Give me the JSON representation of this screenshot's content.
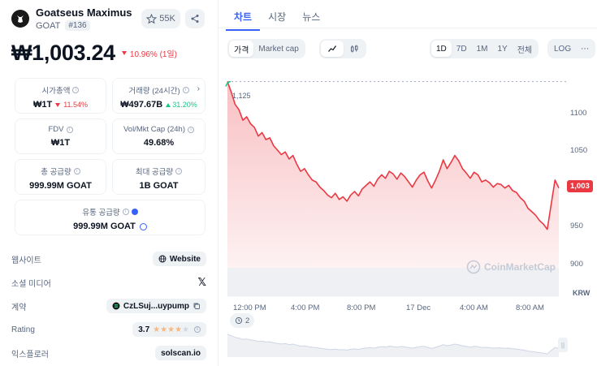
{
  "coin": {
    "name": "Goatseus Maximus",
    "symbol": "GOAT",
    "rank": "#136",
    "watchlist_count": "55K",
    "price": "₩1,003.24",
    "change": "10.96% (1일)"
  },
  "stats": {
    "market_cap": {
      "label": "시가총액",
      "value": "₩1T",
      "change": "11.54%"
    },
    "volume": {
      "label": "거래량 (24시간)",
      "value": "₩497.67B",
      "change": "31.20%"
    },
    "fdv": {
      "label": "FDV",
      "value": "₩1T"
    },
    "vol_mkt_cap": {
      "label": "Vol/Mkt Cap (24h)",
      "value": "49.68%"
    },
    "total_supply": {
      "label": "총 공급량",
      "value": "999.99M GOAT"
    },
    "max_supply": {
      "label": "최대 공급량",
      "value": "1B GOAT"
    },
    "circulating_supply": {
      "label": "유통 공급량",
      "value": "999.99M GOAT"
    }
  },
  "info": {
    "website": {
      "label": "웹사이트",
      "value": "Website"
    },
    "social": {
      "label": "소셜 미디어",
      "value": "𝕏"
    },
    "contract": {
      "label": "계약",
      "value": "CzLSuj...uypump"
    },
    "rating": {
      "label": "Rating",
      "value": "3.7"
    },
    "explorer": {
      "label": "익스플로러",
      "value": "solscan.io"
    }
  },
  "tabs": [
    "차트",
    "시장",
    "뉴스"
  ],
  "controls": {
    "type_options": [
      "가격",
      "Market cap"
    ],
    "ranges": [
      "1D",
      "7D",
      "1M",
      "1Y",
      "전체"
    ],
    "log_label": "LOG",
    "more": "⋯"
  },
  "chart_data": {
    "type": "area",
    "title": "",
    "currency": "KRW",
    "x_ticks": [
      "12:00 PM",
      "4:00 PM",
      "8:00 PM",
      "17 Dec",
      "4:00 AM",
      "8:00 AM"
    ],
    "y_ticks": [
      1100,
      1050,
      1000,
      950,
      900
    ],
    "ylim": [
      880,
      1130
    ],
    "high_label": "1,125",
    "current_label": "1,003",
    "series": [
      {
        "values": [
          1124,
          1112,
          1098,
          1092,
          1080,
          1084,
          1076,
          1072,
          1062,
          1066,
          1058,
          1060,
          1051,
          1046,
          1041,
          1044,
          1036,
          1040,
          1030,
          1022,
          1025,
          1018,
          1012,
          1010,
          1004,
          1000,
          995,
          992,
          997,
          990,
          993,
          988,
          995,
          999,
          994,
          1002,
          1006,
          1010,
          1005,
          1013,
          1018,
          1014,
          1022,
          1019,
          1013,
          1020,
          1016,
          1010,
          1004,
          1012,
          1018,
          1021,
          1011,
          1003,
          1012,
          1022,
          1035,
          1025,
          1032,
          1040,
          1034,
          1025,
          1020,
          1014,
          1021,
          1018,
          1010,
          1012,
          1009,
          1004,
          1008,
          1007,
          1003,
          1006,
          1000,
          998,
          992,
          988,
          980,
          976,
          972,
          966,
          962,
          956,
          984,
          1012,
          1003
        ]
      }
    ],
    "volume_label": ""
  },
  "watermark": "CoinMarketCap",
  "events_count": "2",
  "colors": {
    "accent": "#3861fb",
    "negative": "#ea3943",
    "positive": "#16c784"
  }
}
